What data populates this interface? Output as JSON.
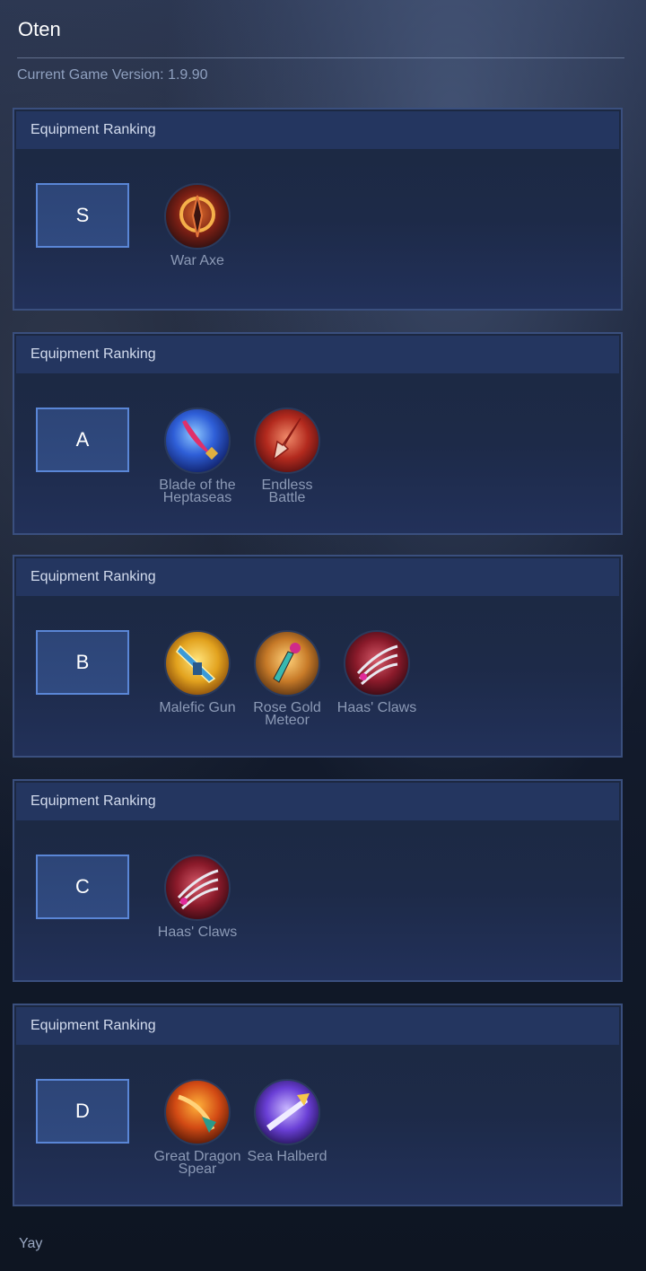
{
  "header": {
    "title": "Oten",
    "version_text": "Current Game Version: 1.9.90"
  },
  "rankings": [
    {
      "heading": "Equipment Ranking",
      "tier": "S",
      "items": [
        {
          "name": "War Axe",
          "icon": "war-axe-icon"
        }
      ]
    },
    {
      "heading": "Equipment Ranking",
      "tier": "A",
      "items": [
        {
          "name": "Blade of the Heptaseas",
          "icon": "blade-of-the-heptaseas-icon"
        },
        {
          "name": "Endless Battle",
          "icon": "endless-battle-icon"
        }
      ]
    },
    {
      "heading": "Equipment Ranking",
      "tier": "B",
      "items": [
        {
          "name": "Malefic Gun",
          "icon": "malefic-gun-icon"
        },
        {
          "name": "Rose Gold Meteor",
          "icon": "rose-gold-meteor-icon"
        },
        {
          "name": "Haas' Claws",
          "icon": "haas-claws-icon"
        }
      ]
    },
    {
      "heading": "Equipment Ranking",
      "tier": "C",
      "items": [
        {
          "name": "Haas' Claws",
          "icon": "haas-claws-icon"
        }
      ]
    },
    {
      "heading": "Equipment Ranking",
      "tier": "D",
      "items": [
        {
          "name": "Great Dragon Spear",
          "icon": "great-dragon-spear-icon"
        },
        {
          "name": "Sea Halberd",
          "icon": "sea-halberd-icon"
        }
      ]
    }
  ],
  "footer": {
    "text": "Yay"
  },
  "colors": {
    "accent_border": "#5a86d6",
    "panel_border": "#3a4f7e",
    "panel_header": "#243660"
  }
}
